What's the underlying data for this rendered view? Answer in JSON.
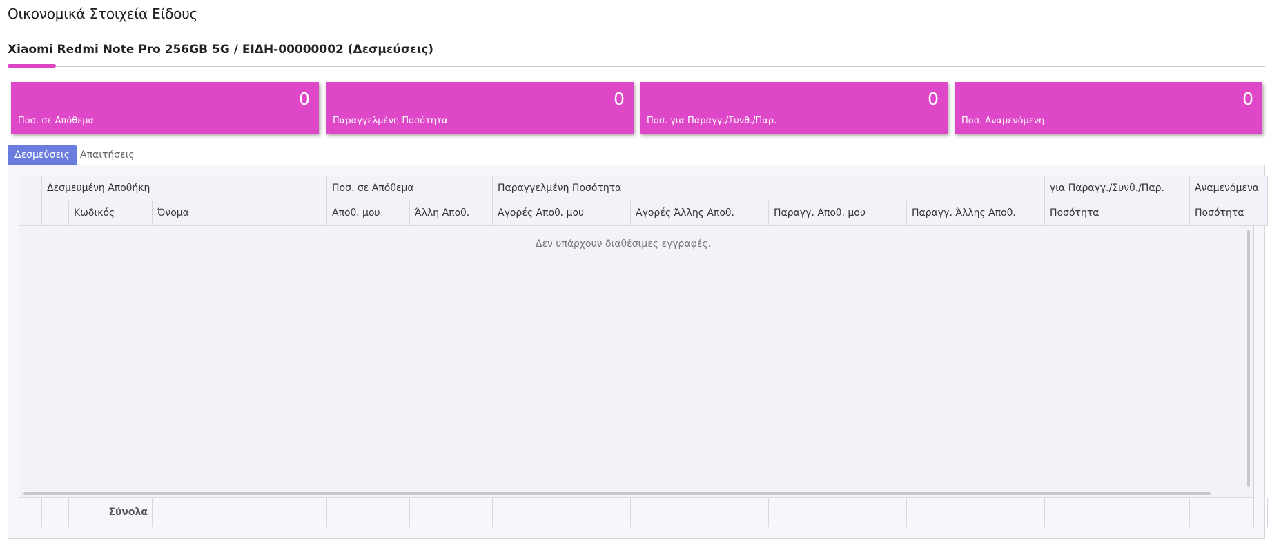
{
  "page": {
    "title": "Οικονομικά Στοιχεία Είδους"
  },
  "item": {
    "title": "Xiaomi Redmi Note Pro 256GB 5G / ΕΙΔΗ-00000002 (Δεσμεύσεις)"
  },
  "colors": {
    "card_bg": "#de48c8",
    "accent_underline": "#dc45c1",
    "tab_active": "#6a7ddf"
  },
  "cards": [
    {
      "value": "0",
      "label": "Ποσ. σε Απόθεμα"
    },
    {
      "value": "0",
      "label": "Παραγγελμένη Ποσότητα"
    },
    {
      "value": "0",
      "label": "Ποσ. για Παραγγ./Συνθ./Παρ."
    },
    {
      "value": "0",
      "label": "Ποσ. Αναμενόμενη"
    }
  ],
  "tabs": [
    {
      "label": "Δεσμεύσεις",
      "active": true
    },
    {
      "label": "Απαιτήσεις",
      "active": false
    }
  ],
  "table": {
    "group_headers": {
      "warehouse": "Δεσμευμένη Αποθήκη",
      "stock": "Ποσ. σε Απόθεμα",
      "ordered": "Παραγγελμένη Ποσότητα",
      "production": "για Παραγγ./Συνθ./Παρ.",
      "expected": "Αναμενόμενα"
    },
    "columns": {
      "code": "Κωδικός",
      "name": "Όνομα",
      "my_wh": "Αποθ. μου",
      "other_wh": "Άλλη Αποθ.",
      "purch_my": "Αγορές Αποθ. μου",
      "purch_other": "Αγορές Άλλης Αποθ.",
      "ord_my": "Παραγγ. Αποθ. μου",
      "ord_other": "Παραγγ. Άλλης Αποθ.",
      "qty1": "Ποσότητα",
      "qty2": "Ποσότητα"
    },
    "empty_message": "Δεν υπάρχουν διαθέσιμες εγγραφές.",
    "totals_label": "Σύνολα"
  }
}
